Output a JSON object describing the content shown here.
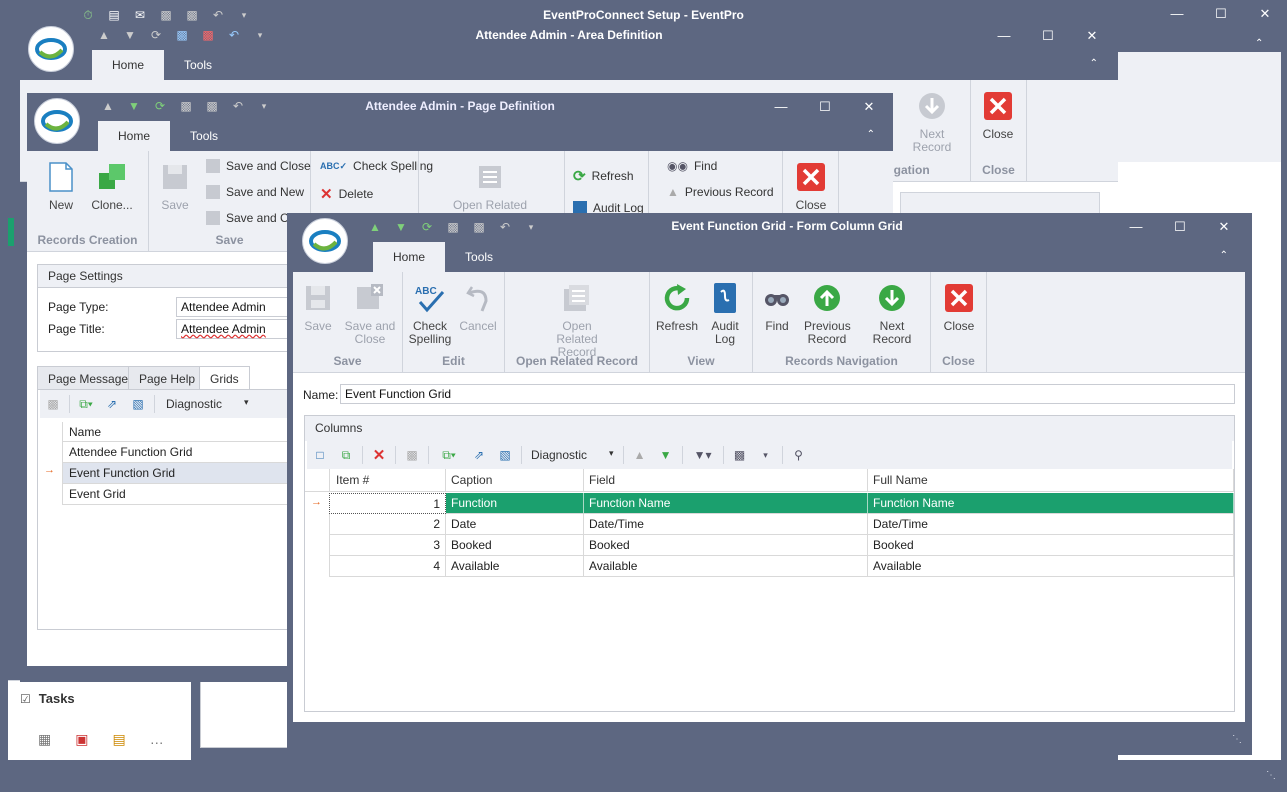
{
  "colors": {
    "frame": "#5d6781",
    "ribbon": "#eef0f5",
    "selection": "#1ba06e",
    "close_red": "#e23b35",
    "green": "#3aa845"
  },
  "main": {
    "title": "EventProConnect Setup - EventPro",
    "tasks": "Tasks"
  },
  "area": {
    "title": "Attendee Admin - Area Definition",
    "tabs": [
      "Home",
      "Tools"
    ],
    "next_record": "Next Record",
    "close": "Close",
    "grp_nav": "igation",
    "grp_close": "Close"
  },
  "page": {
    "title": "Attendee Admin - Page Definition",
    "tabs": [
      "Home",
      "Tools"
    ],
    "new": "New",
    "clone": "Clone...",
    "save": "Save",
    "save_close": "Save and Close",
    "save_new": "Save and New",
    "save_clo": "Save and Clo",
    "check_spelling": "Check Spelling",
    "delete": "Delete",
    "open_related": "Open Related",
    "refresh": "Refresh",
    "audit_log": "Audit Log",
    "find": "Find",
    "previous_record": "Previous Record",
    "close": "Close",
    "grp_records": "Records Creation",
    "grp_save": "Save",
    "settings_title": "Page Settings",
    "page_type_label": "Page Type:",
    "page_type": "Attendee Admin",
    "page_title_label": "Page Title:",
    "page_title": "Attendee Admin",
    "bottom_tabs": [
      "Page Message",
      "Page Help",
      "Grids"
    ],
    "diagnostic": "Diagnostic",
    "name_header": "Name",
    "grids": [
      "Attendee Function Grid",
      "Event Function Grid",
      "Event Grid"
    ]
  },
  "efg": {
    "title": "Event Function Grid - Form Column Grid",
    "tabs": [
      "Home",
      "Tools"
    ],
    "save": "Save",
    "save_close": "Save and Close",
    "check_spelling": "Check Spelling",
    "cancel": "Cancel",
    "open_related": "Open Related Record",
    "refresh": "Refresh",
    "audit_log": "Audit Log",
    "find": "Find",
    "previous_record": "Previous Record",
    "next_record": "Next Record",
    "close": "Close",
    "grp_save": "Save",
    "grp_edit": "Edit",
    "grp_open": "Open Related Record",
    "grp_view": "View",
    "grp_nav": "Records Navigation",
    "grp_close": "Close",
    "name_label": "Name:",
    "name_value": "Event Function Grid",
    "columns_title": "Columns",
    "diagnostic": "Diagnostic",
    "headers": [
      "Item #",
      "Caption",
      "Field",
      "Full Name"
    ],
    "rows": [
      {
        "item": "1",
        "caption": "Function",
        "field": "Function Name",
        "full": "Function Name"
      },
      {
        "item": "2",
        "caption": "Date",
        "field": "Date/Time",
        "full": "Date/Time"
      },
      {
        "item": "3",
        "caption": "Booked",
        "field": "Booked",
        "full": "Booked"
      },
      {
        "item": "4",
        "caption": "Available",
        "field": "Available",
        "full": "Available"
      }
    ]
  }
}
